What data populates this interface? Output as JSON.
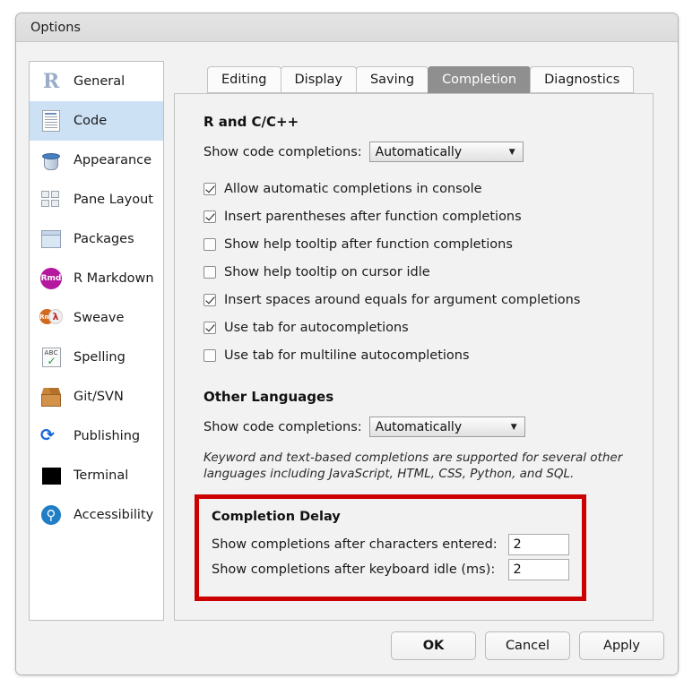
{
  "dialog": {
    "title": "Options"
  },
  "sidebar": {
    "items": [
      {
        "label": "General",
        "icon": "r-logo-icon"
      },
      {
        "label": "Code",
        "icon": "code-document-icon"
      },
      {
        "label": "Appearance",
        "icon": "paint-bucket-icon"
      },
      {
        "label": "Pane Layout",
        "icon": "pane-layout-icon"
      },
      {
        "label": "Packages",
        "icon": "package-box-icon"
      },
      {
        "label": "R Markdown",
        "icon": "rmd-badge-icon"
      },
      {
        "label": "Sweave",
        "icon": "sweave-rnw-pdf-icon"
      },
      {
        "label": "Spelling",
        "icon": "spelling-abc-check-icon"
      },
      {
        "label": "Git/SVN",
        "icon": "git-box-icon"
      },
      {
        "label": "Publishing",
        "icon": "publishing-icon"
      },
      {
        "label": "Terminal",
        "icon": "terminal-icon"
      },
      {
        "label": "Accessibility",
        "icon": "accessibility-icon"
      }
    ],
    "selected": "Code"
  },
  "tabs": [
    {
      "label": "Editing",
      "active": false
    },
    {
      "label": "Display",
      "active": false
    },
    {
      "label": "Saving",
      "active": false
    },
    {
      "label": "Completion",
      "active": true
    },
    {
      "label": "Diagnostics",
      "active": false
    }
  ],
  "main": {
    "r_cpp": {
      "heading": "R and C/C++",
      "completions_label": "Show code completions:",
      "completions_value": "Automatically",
      "checkboxes": [
        {
          "label": "Allow automatic completions in console",
          "checked": true
        },
        {
          "label": "Insert parentheses after function completions",
          "checked": true
        },
        {
          "label": "Show help tooltip after function completions",
          "checked": false
        },
        {
          "label": "Show help tooltip on cursor idle",
          "checked": false
        },
        {
          "label": "Insert spaces around equals for argument completions",
          "checked": true
        },
        {
          "label": "Use tab for autocompletions",
          "checked": true
        },
        {
          "label": "Use tab for multiline autocompletions",
          "checked": false
        }
      ]
    },
    "other_languages": {
      "heading": "Other Languages",
      "completions_label": "Show code completions:",
      "completions_value": "Automatically",
      "note": "Keyword and text-based completions are supported for several other languages including JavaScript, HTML, CSS, Python, and SQL."
    },
    "completion_delay": {
      "heading": "Completion Delay",
      "chars_label": "Show completions after characters entered:",
      "chars_value": "2",
      "idle_label": "Show completions after keyboard idle (ms):",
      "idle_value": "2",
      "highlight_color": "#cc0000"
    }
  },
  "footer": {
    "ok": "OK",
    "cancel": "Cancel",
    "apply": "Apply"
  },
  "icons": {
    "dropdown_arrow": "▼",
    "rmd_text": "Rmd",
    "rnw_text": "Rnw",
    "pdf_glyph": "λ",
    "abc_text": "ABC",
    "check_glyph": "✓",
    "publishing_glyph": "⟳",
    "accessibility_glyph": "⚲",
    "r_glyph": "R"
  }
}
